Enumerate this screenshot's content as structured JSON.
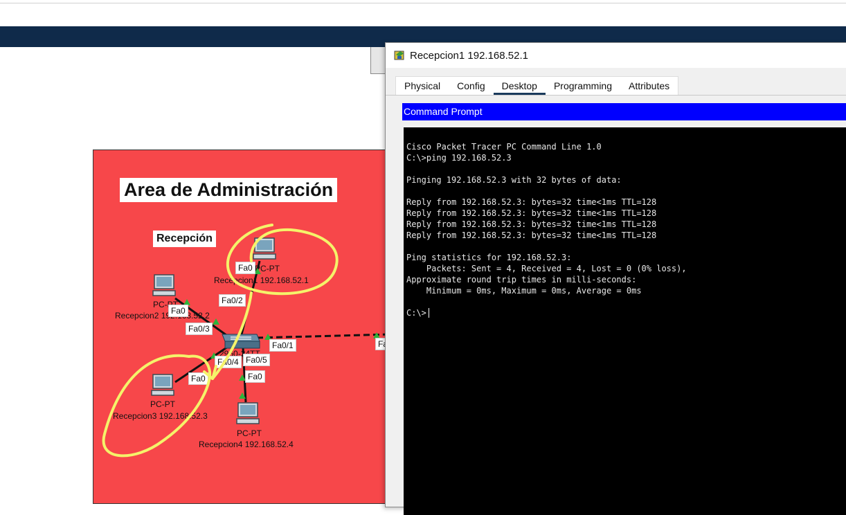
{
  "window": {
    "title": "Recepcion1 192.168.52.1"
  },
  "tabs": [
    {
      "label": "Physical"
    },
    {
      "label": "Config"
    },
    {
      "label": "Desktop"
    },
    {
      "label": "Programming"
    },
    {
      "label": "Attributes"
    }
  ],
  "active_tab": "Desktop",
  "command_prompt": {
    "header": "Command Prompt",
    "lines": [
      "Cisco Packet Tracer PC Command Line 1.0",
      "C:\\>ping 192.168.52.3",
      "",
      "Pinging 192.168.52.3 with 32 bytes of data:",
      "",
      "Reply from 192.168.52.3: bytes=32 time<1ms TTL=128",
      "Reply from 192.168.52.3: bytes=32 time<1ms TTL=128",
      "Reply from 192.168.52.3: bytes=32 time<1ms TTL=128",
      "Reply from 192.168.52.3: bytes=32 time<1ms TTL=128",
      "",
      "Ping statistics for 192.168.52.3:",
      "    Packets: Sent = 4, Received = 4, Lost = 0 (0% loss),",
      "Approximate round trip times in milli-seconds:",
      "    Minimum = 0ms, Maximum = 0ms, Average = 0ms",
      "",
      "C:\\>"
    ]
  },
  "workspace": {
    "area_title": "Area de Administración",
    "section_label": "Recepción",
    "devices": [
      {
        "type": "PC-PT",
        "name": "Recepcion1 192.168.52.1"
      },
      {
        "type": "PC-PT",
        "name": "Recepcion2 192.168.52.2"
      },
      {
        "type": "PC-PT",
        "name": "Recepcion3 192.168.52.3"
      },
      {
        "type": "PC-PT",
        "name": "Recepcion4 192.168.52.4"
      }
    ],
    "switch_label": "2960-24TT",
    "ports": {
      "pc1_fa0": "Fa0",
      "pc2_fa0": "Fa0",
      "pc3_fa0": "Fa0",
      "pc4_fa0": "Fa0",
      "sw_fa02": "Fa0/2",
      "sw_fa03": "Fa0/3",
      "sw_fa04": "Fa0/4",
      "sw_fa05": "Fa0/5",
      "sw_fa01": "Fa0/1",
      "edge_fa": "Fa"
    }
  },
  "colors": {
    "area_bg": "#f7474a",
    "navbar": "#0f2a4a",
    "cmd_header": "#0000ff",
    "terminal_bg": "#000000",
    "scribble": "#f5f36a",
    "link_up": "#2db43a"
  }
}
